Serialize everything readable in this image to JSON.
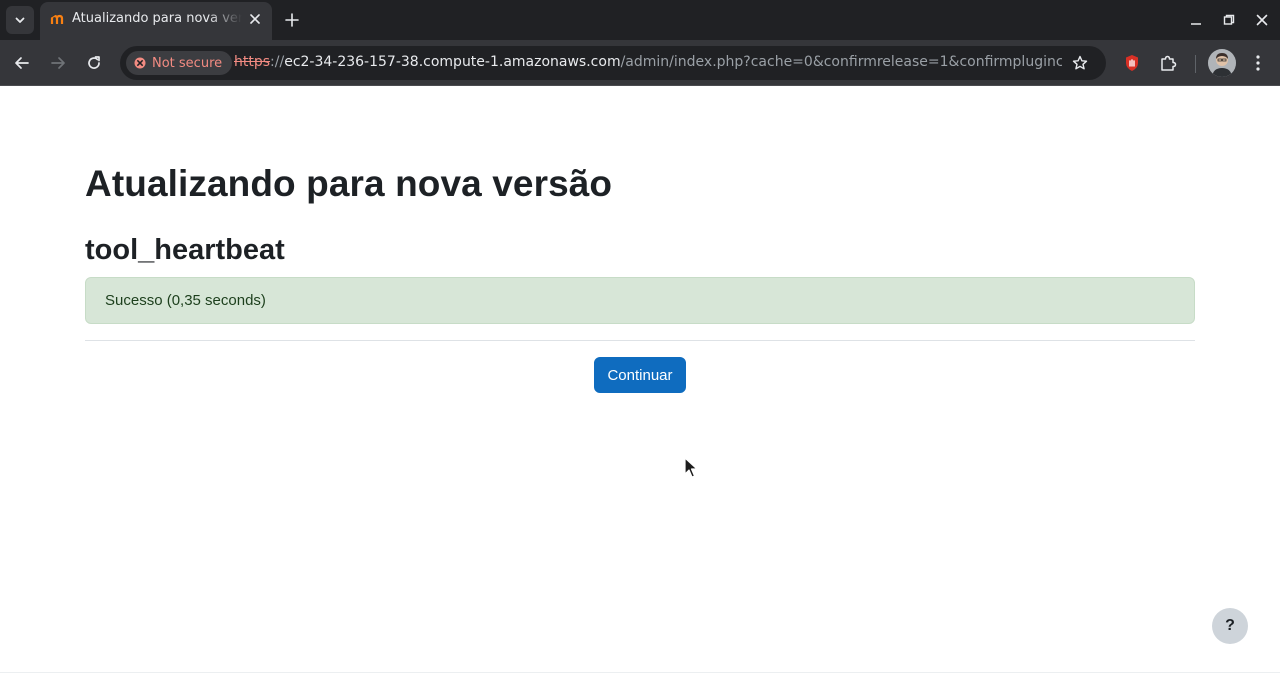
{
  "browser": {
    "tab": {
      "title": "Atualizando para nova versão",
      "favicon": "moodle-favicon-icon"
    },
    "address_bar": {
      "security_label": "Not secure",
      "url_scheme": "https",
      "url_separator": "://",
      "url_host": "ec2-34-236-157-38.compute-1.amazonaws.com",
      "url_path": "/admin/index.php?cache=0&confirmrelease=1&confirmplugincheck..."
    },
    "icons": {
      "tab_list": "chevron-down-icon",
      "tab_close": "close-icon",
      "new_tab": "plus-icon",
      "back": "arrow-left-icon",
      "forward": "arrow-right-icon",
      "reload": "reload-icon",
      "bookmark": "star-icon",
      "extension_blocker": "hand-stop-icon",
      "extensions": "puzzle-icon",
      "menu": "kebab-menu-icon"
    },
    "colors": {
      "tabbar": "#202124",
      "toolbar": "#35363a",
      "not_secure": "#f28b82"
    }
  },
  "page": {
    "title": "Atualizando para nova versão",
    "plugin_name": "tool_heartbeat",
    "status_message": "Sucesso (0,35 seconds)",
    "continue_label": "Continuar",
    "help_label": "?",
    "colors": {
      "primary_button": "#0f6cbf",
      "success_bg": "#d7e6d7",
      "heading": "#1d2125"
    }
  }
}
